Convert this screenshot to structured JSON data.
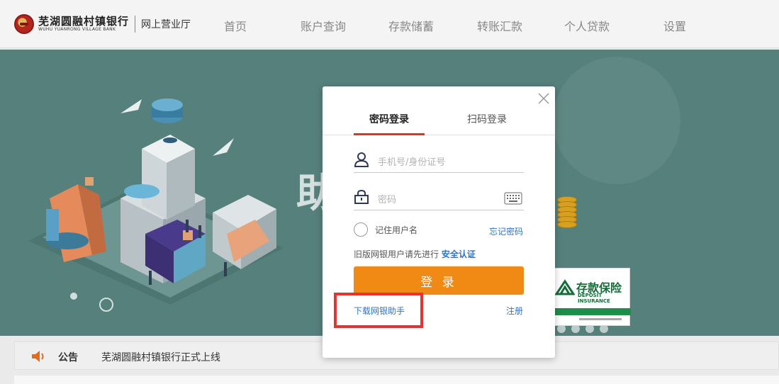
{
  "header": {
    "bank_name_cn": "芜湖圆融村镇银行",
    "bank_name_en": "WUHU YUANRONG VILLAGE BANK",
    "subtitle": "网上营业厅",
    "nav": [
      "首页",
      "账户查询",
      "存款储蓄",
      "转账汇款",
      "个人贷款",
      "设置"
    ]
  },
  "banner": {
    "big_char": "助",
    "deposit_cn": "存款保险",
    "deposit_en": "DEPOSIT INSURANCE"
  },
  "login": {
    "tabs": [
      "密码登录",
      "扫码登录"
    ],
    "active_tab": 0,
    "username_placeholder": "手机号/身份证号",
    "password_placeholder": "密码",
    "remember_label": "记住用户名",
    "forgot_label": "忘记密码",
    "old_version_text": "旧版网银用户请先进行",
    "security_auth_label": "安全认证",
    "login_button": "登 录",
    "download_label": "下载网银助手",
    "register_label": "注册"
  },
  "notice": {
    "tag": "公告",
    "text": "芜湖圆融村镇银行正式上线"
  },
  "colors": {
    "banner_bg": "#56807c",
    "login_button": "#f08a15",
    "link": "#2f73c4",
    "tab_underline": "#a84a3c",
    "highlight": "#e8322f"
  }
}
